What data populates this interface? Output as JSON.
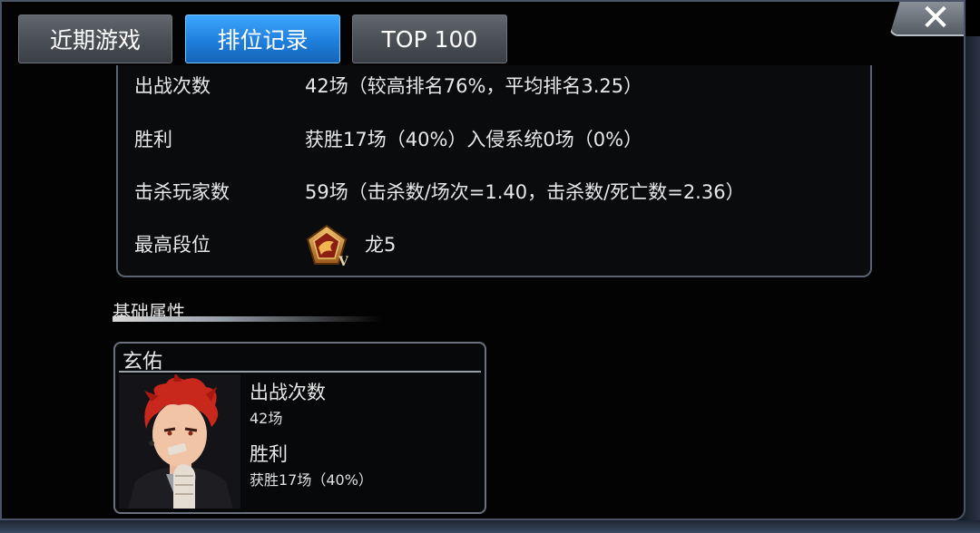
{
  "tabs": [
    {
      "label": "近期游戏",
      "active": false
    },
    {
      "label": "排位记录",
      "active": true
    },
    {
      "label": "TOP 100",
      "active": false
    }
  ],
  "close_icon": "close-icon",
  "stats": {
    "rows": [
      {
        "label": "出战次数",
        "value": "42场（较高排名76%，平均排名3.25）"
      },
      {
        "label": "胜利",
        "value": "获胜17场（40%）入侵系统0场（0%）"
      },
      {
        "label": "击杀玩家数",
        "value": "59场（击杀数/场次=1.40，击杀数/死亡数=2.36）"
      },
      {
        "label": "最高段位",
        "value": "龙5",
        "icon": "dragon-rank-emblem-icon"
      }
    ]
  },
  "section": {
    "title": "基础属性"
  },
  "character": {
    "name": "玄佑",
    "stat1_label": "出战次数",
    "stat1_value": "42场",
    "stat2_label": "胜利",
    "stat2_value": "获胜17场（40%）"
  },
  "colors": {
    "active_tab": "#1f7fdc",
    "inactive_tab": "#4b5057",
    "panel_border": "#5b6371",
    "emblem_gold": "#c9822f"
  }
}
